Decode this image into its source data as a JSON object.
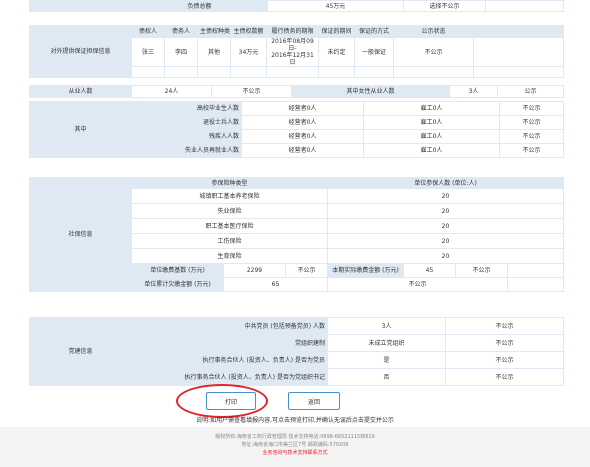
{
  "debt_total": {
    "label": "负债总额",
    "value": "45万元",
    "status": "选择不公示"
  },
  "guarantee": {
    "section_label": "对外提供保证担保信息",
    "headers": [
      "债权人",
      "债务人",
      "主债权种类",
      "主债权数额",
      "履行债务的期限",
      "保证的期间",
      "保证的方式",
      "公示状态"
    ],
    "row": [
      "张三",
      "李四",
      "其他",
      "34万元",
      "2016年08月09日-\n2016年12月31日",
      "未约定",
      "一般保证",
      "不公示"
    ]
  },
  "employees": {
    "label": "从业人数",
    "count": "24人",
    "status": "不公示",
    "female_label": "其中女性从业人数",
    "female_count": "3人",
    "female_status": "公示",
    "group_label": "其中",
    "rows": [
      {
        "label": "高校毕业生人数",
        "a": "经营者0人",
        "b": "雇工0人",
        "s": "不公示"
      },
      {
        "label": "退役士兵人数",
        "a": "经营者0人",
        "b": "雇工0人",
        "s": "不公示"
      },
      {
        "label": "残疾人人数",
        "a": "经营者0人",
        "b": "雇工0人",
        "s": "不公示"
      },
      {
        "label": "失业人员再就业人数",
        "a": "经营者0人",
        "b": "雇工0人",
        "s": "不公示"
      }
    ]
  },
  "social": {
    "section_label": "社保信息",
    "col_type": "参保险种类型",
    "col_count": "单位参保人数 (单位:人)",
    "rows": [
      {
        "type": "城镇职工基本养老保险",
        "count": "20"
      },
      {
        "type": "失业保险",
        "count": "20"
      },
      {
        "type": "职工基本医疗保险",
        "count": "20"
      },
      {
        "type": "工伤保险",
        "count": "20"
      },
      {
        "type": "生育保险",
        "count": "20"
      }
    ],
    "base_label": "单位缴费基数 (万元)",
    "base_value": "2299",
    "base_status": "不公示",
    "paid_label": "本期实际缴费金额 (万元)",
    "paid_value": "45",
    "paid_status": "不公示",
    "arrears_label": "单位累计欠缴金额 (万元)",
    "arrears_value": "65",
    "arrears_status": "不公示"
  },
  "party": {
    "section_label": "党建信息",
    "rows": [
      {
        "label": "中共党员 (包括预备党员) 人数",
        "value": "3人",
        "status": "不公示"
      },
      {
        "label": "党组织建制",
        "value": "未成立党组织",
        "status": "不公示"
      },
      {
        "label": "执行事务合伙人 (投资人、负责人) 是否为党员",
        "value": "是",
        "status": "不公示"
      },
      {
        "label": "执行事务合伙人 (投资人、负责人) 是否为党组织书记",
        "value": "否",
        "status": "不公示"
      }
    ]
  },
  "actions": {
    "print": "打印",
    "back": "返回"
  },
  "note": "说明:如用户需查看填报内容,可点击预览打印,并确认无误后点击提交并公示",
  "footer": {
    "line1": "版权所有:海南省工商行政管理局 技术支持电话:0898-66521115转819",
    "line2": "地址:海南省海口市美兰区7号 邮政编码:570206",
    "line3": "业务咨询与技术支持联系方式"
  },
  "colors": {
    "header_bg": "#dfe9f3",
    "button_border": "#4a90c8",
    "highlight_ring": "#e0242a"
  }
}
